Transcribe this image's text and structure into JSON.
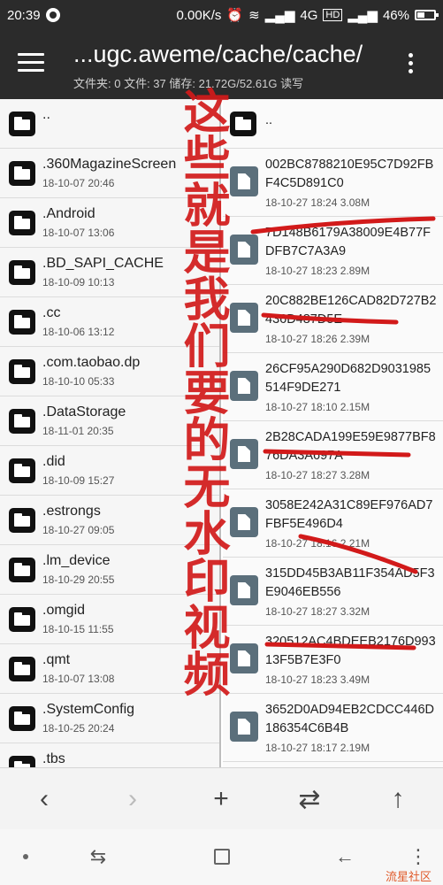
{
  "status": {
    "time": "20:39",
    "speed": "0.00K/s",
    "network": "4G",
    "hd": "HD",
    "battery_percent": "46%",
    "battery_level": 0.46
  },
  "appbar": {
    "title": "...ugc.aweme/cache/cache/",
    "subtitle": "文件夹: 0  文件: 37  储存: 21.72G/52.61G  读写"
  },
  "left_panel": {
    "items": [
      {
        "name": "..",
        "meta": ""
      },
      {
        "name": ".360MagazineScreen",
        "meta": "18-10-07 20:46"
      },
      {
        "name": ".Android",
        "meta": "18-10-07 13:06"
      },
      {
        "name": ".BD_SAPI_CACHE",
        "meta": "18-10-09 10:13"
      },
      {
        "name": ".cc",
        "meta": "18-10-06 13:12"
      },
      {
        "name": ".com.taobao.dp",
        "meta": "18-10-10 05:33"
      },
      {
        "name": ".DataStorage",
        "meta": "18-11-01 20:35"
      },
      {
        "name": ".did",
        "meta": "18-10-09 15:27"
      },
      {
        "name": ".estrongs",
        "meta": "18-10-27 09:05"
      },
      {
        "name": ".lm_device",
        "meta": "18-10-29 20:55"
      },
      {
        "name": ".omgid",
        "meta": "18-10-15 11:55"
      },
      {
        "name": ".qmt",
        "meta": "18-10-07 13:08"
      },
      {
        "name": ".SystemConfig",
        "meta": "18-10-25 20:24"
      },
      {
        "name": ".tbs",
        "meta": ""
      }
    ]
  },
  "right_panel": {
    "up": "..",
    "items": [
      {
        "name": "002BC8788210E95C7D92FBF4C5D891C0",
        "meta": "18-10-27 18:24  3.08M"
      },
      {
        "name": "7D148B6179A38009E4B77FDFB7C7A3A9",
        "meta": "18-10-27 18:23  2.89M"
      },
      {
        "name": "20C882BE126CAD82D727B2436D487D5E",
        "meta": "18-10-27 18:26  2.39M"
      },
      {
        "name": "26CF95A290D682D9031985514F9DE271",
        "meta": "18-10-27 18:10  2.15M"
      },
      {
        "name": "2B28CADA199E59E9877BF876DA3A697A",
        "meta": "18-10-27 18:27  3.28M"
      },
      {
        "name": "3058E242A31C89EF976AD7FBF5E496D4",
        "meta": "18-10-27 18:16  2.21M"
      },
      {
        "name": "315DD45B3AB11F354AD5F3E9046EB556",
        "meta": "18-10-27 18:27  3.32M"
      },
      {
        "name": "320512AC4BDEEB2176D99313F5B7E3F0",
        "meta": "18-10-27 18:23  3.49M"
      },
      {
        "name": "3652D0AD94EB2CDCC446D186354C6B4B",
        "meta": "18-10-27 18:17  2.19M"
      },
      {
        "name": "45189D8224A2E4697",
        "meta": ""
      }
    ]
  },
  "annotation": {
    "text": "这些就是我们要的无水印视频",
    "color": "#d21a1a"
  },
  "toolbar": {
    "back": "‹",
    "forward": "›",
    "add": "+",
    "swap": "⇄",
    "up": "↑"
  },
  "navbar": {
    "menu": "⇆",
    "back": "←",
    "more": "⋮"
  },
  "watermark": "流星社区"
}
